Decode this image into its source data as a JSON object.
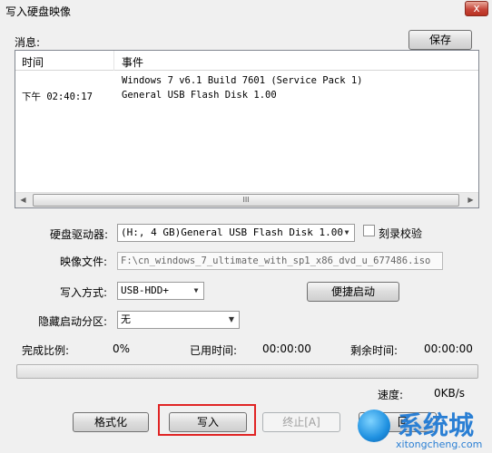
{
  "window": {
    "title": "写入硬盘映像",
    "close_glyph": "x"
  },
  "messages": {
    "label": "消息:",
    "save_button": "保存",
    "columns": [
      "时间",
      "事件"
    ],
    "rows": [
      {
        "time": "",
        "event": "Windows 7 v6.1 Build 7601 (Service Pack 1)"
      },
      {
        "time": "下午 02:40:17",
        "event": "General USB Flash Disk  1.00"
      }
    ],
    "scroll_thumb_grip": "III"
  },
  "form": {
    "drive_label": "硬盘驱动器:",
    "drive_value": "(H:, 4 GB)General USB Flash Disk  1.00",
    "verify_label": "刻录校验",
    "image_label": "映像文件:",
    "image_value": "F:\\cn_windows_7_ultimate_with_sp1_x86_dvd_u_677486.iso",
    "method_label": "写入方式:",
    "method_value": "USB-HDD+",
    "quick_boot_button": "便捷启动",
    "hidden_partition_label": "隐藏启动分区:",
    "hidden_partition_value": "无"
  },
  "status": {
    "complete_label": "完成比例:",
    "complete_value": "0%",
    "elapsed_label": "已用时间:",
    "elapsed_value": "00:00:00",
    "remaining_label": "剩余时间:",
    "remaining_value": "00:00:00",
    "progress_fraction": 0,
    "speed_label": "速度:",
    "speed_value": "0KB/s"
  },
  "buttons": {
    "format": "格式化",
    "write": "写入",
    "stop": "终止[A]",
    "back_partial": "回"
  },
  "watermark": {
    "text": "系统城",
    "subtext": "xitongcheng.com"
  },
  "colors": {
    "highlight": "#e02424",
    "watermark": "#2a7fd4"
  }
}
